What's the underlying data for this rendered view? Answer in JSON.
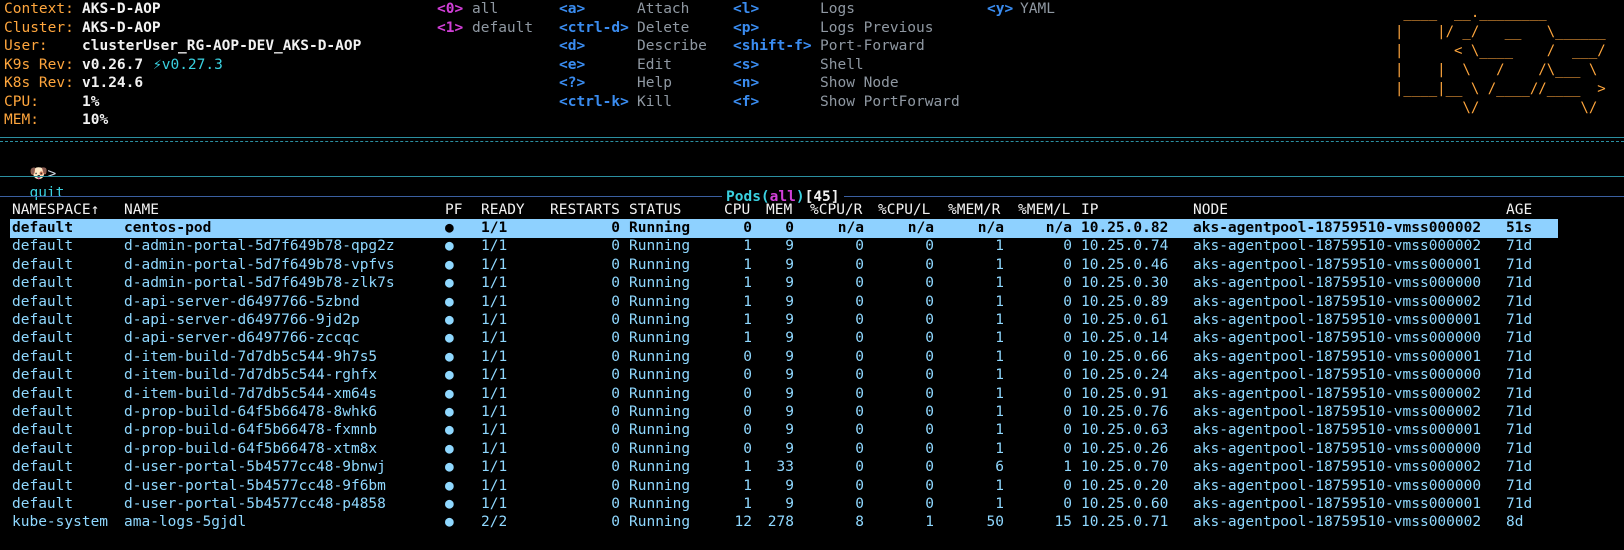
{
  "info": [
    {
      "label": "Context:",
      "value": "AKS-D-AOP"
    },
    {
      "label": "Cluster:",
      "value": "AKS-D-AOP"
    },
    {
      "label": "User:",
      "value": "clusterUser_RG-AOP-DEV_AKS-D-AOP"
    },
    {
      "label": "K9s Rev:",
      "value": "v0.26.7",
      "extra": "⚡v0.27.3"
    },
    {
      "label": "K8s Rev:",
      "value": "v1.24.6"
    },
    {
      "label": "CPU:",
      "value": "1%"
    },
    {
      "label": "MEM:",
      "value": "10%"
    }
  ],
  "namespaces": [
    {
      "key": "<0>",
      "label": "all"
    },
    {
      "key": "<1>",
      "label": "default"
    }
  ],
  "shortcuts_col1": [
    {
      "key": "<a>",
      "label": "Attach"
    },
    {
      "key": "<ctrl-d>",
      "label": "Delete"
    },
    {
      "key": "<d>",
      "label": "Describe"
    },
    {
      "key": "<e>",
      "label": "Edit"
    },
    {
      "key": "<?>",
      "label": "Help"
    },
    {
      "key": "<ctrl-k>",
      "label": "Kill"
    }
  ],
  "shortcuts_col2": [
    {
      "key": "<l>",
      "label": "Logs"
    },
    {
      "key": "<p>",
      "label": "Logs Previous"
    },
    {
      "key": "<shift-f>",
      "label": "Port-Forward"
    },
    {
      "key": "<s>",
      "label": "Shell"
    },
    {
      "key": "<n>",
      "label": "Show Node"
    },
    {
      "key": "<f>",
      "label": "Show PortForward"
    }
  ],
  "shortcuts_col3": [
    {
      "key": "<y>",
      "label": "YAML"
    }
  ],
  "logo_lines": [
    " ____  __.________       ",
    "|    |/ _/   __   \\______",
    "|      < \\____    /  ___/",
    "|    |  \\   /    /\\___ \\ ",
    "|____|__ \\ /____//____  >",
    "        \\/            \\/ "
  ],
  "prompt": {
    "icon": "🐶>",
    "text": "quit"
  },
  "title": {
    "resource": "Pods",
    "paren_open": "(",
    "namespace": "all",
    "paren_close": ")",
    "count": "[45]"
  },
  "headers": [
    "NAMESPACE↑",
    "NAME",
    "PF",
    "READY",
    "RESTARTS",
    "STATUS",
    "CPU",
    "MEM",
    "%CPU/R",
    "%CPU/L",
    "%MEM/R",
    "%MEM/L",
    "IP",
    "NODE",
    "AGE"
  ],
  "rows": [
    [
      "default",
      "centos-pod",
      "●",
      "1/1",
      "0",
      "Running",
      "0",
      "0",
      "n/a",
      "n/a",
      "n/a",
      "n/a",
      "10.25.0.82",
      "aks-agentpool-18759510-vmss000002",
      "51s"
    ],
    [
      "default",
      "d-admin-portal-5d7f649b78-qpg2z",
      "●",
      "1/1",
      "0",
      "Running",
      "1",
      "9",
      "0",
      "0",
      "1",
      "0",
      "10.25.0.74",
      "aks-agentpool-18759510-vmss000002",
      "71d"
    ],
    [
      "default",
      "d-admin-portal-5d7f649b78-vpfvs",
      "●",
      "1/1",
      "0",
      "Running",
      "1",
      "9",
      "0",
      "0",
      "1",
      "0",
      "10.25.0.46",
      "aks-agentpool-18759510-vmss000001",
      "71d"
    ],
    [
      "default",
      "d-admin-portal-5d7f649b78-zlk7s",
      "●",
      "1/1",
      "0",
      "Running",
      "1",
      "9",
      "0",
      "0",
      "1",
      "0",
      "10.25.0.30",
      "aks-agentpool-18759510-vmss000000",
      "71d"
    ],
    [
      "default",
      "d-api-server-d6497766-5zbnd",
      "●",
      "1/1",
      "0",
      "Running",
      "1",
      "9",
      "0",
      "0",
      "1",
      "0",
      "10.25.0.89",
      "aks-agentpool-18759510-vmss000002",
      "71d"
    ],
    [
      "default",
      "d-api-server-d6497766-9jd2p",
      "●",
      "1/1",
      "0",
      "Running",
      "1",
      "9",
      "0",
      "0",
      "1",
      "0",
      "10.25.0.61",
      "aks-agentpool-18759510-vmss000001",
      "71d"
    ],
    [
      "default",
      "d-api-server-d6497766-zccqc",
      "●",
      "1/1",
      "0",
      "Running",
      "1",
      "9",
      "0",
      "0",
      "1",
      "0",
      "10.25.0.14",
      "aks-agentpool-18759510-vmss000000",
      "71d"
    ],
    [
      "default",
      "d-item-build-7d7db5c544-9h7s5",
      "●",
      "1/1",
      "0",
      "Running",
      "0",
      "9",
      "0",
      "0",
      "1",
      "0",
      "10.25.0.66",
      "aks-agentpool-18759510-vmss000001",
      "71d"
    ],
    [
      "default",
      "d-item-build-7d7db5c544-rghfx",
      "●",
      "1/1",
      "0",
      "Running",
      "0",
      "9",
      "0",
      "0",
      "1",
      "0",
      "10.25.0.24",
      "aks-agentpool-18759510-vmss000000",
      "71d"
    ],
    [
      "default",
      "d-item-build-7d7db5c544-xm64s",
      "●",
      "1/1",
      "0",
      "Running",
      "0",
      "9",
      "0",
      "0",
      "1",
      "0",
      "10.25.0.91",
      "aks-agentpool-18759510-vmss000002",
      "71d"
    ],
    [
      "default",
      "d-prop-build-64f5b66478-8whk6",
      "●",
      "1/1",
      "0",
      "Running",
      "0",
      "9",
      "0",
      "0",
      "1",
      "0",
      "10.25.0.76",
      "aks-agentpool-18759510-vmss000002",
      "71d"
    ],
    [
      "default",
      "d-prop-build-64f5b66478-fxmnb",
      "●",
      "1/1",
      "0",
      "Running",
      "0",
      "9",
      "0",
      "0",
      "1",
      "0",
      "10.25.0.63",
      "aks-agentpool-18759510-vmss000001",
      "71d"
    ],
    [
      "default",
      "d-prop-build-64f5b66478-xtm8x",
      "●",
      "1/1",
      "0",
      "Running",
      "0",
      "9",
      "0",
      "0",
      "1",
      "0",
      "10.25.0.26",
      "aks-agentpool-18759510-vmss000000",
      "71d"
    ],
    [
      "default",
      "d-user-portal-5b4577cc48-9bnwj",
      "●",
      "1/1",
      "0",
      "Running",
      "1",
      "33",
      "0",
      "0",
      "6",
      "1",
      "10.25.0.70",
      "aks-agentpool-18759510-vmss000002",
      "71d"
    ],
    [
      "default",
      "d-user-portal-5b4577cc48-9f6bm",
      "●",
      "1/1",
      "0",
      "Running",
      "1",
      "9",
      "0",
      "0",
      "1",
      "0",
      "10.25.0.20",
      "aks-agentpool-18759510-vmss000000",
      "71d"
    ],
    [
      "default",
      "d-user-portal-5b4577cc48-p4858",
      "●",
      "1/1",
      "0",
      "Running",
      "1",
      "9",
      "0",
      "0",
      "1",
      "0",
      "10.25.0.60",
      "aks-agentpool-18759510-vmss000001",
      "71d"
    ],
    [
      "kube-system",
      "ama-logs-5gjdl",
      "●",
      "2/2",
      "0",
      "Running",
      "12",
      "278",
      "8",
      "1",
      "50",
      "15",
      "10.25.0.71",
      "aks-agentpool-18759510-vmss000002",
      "8d"
    ]
  ]
}
